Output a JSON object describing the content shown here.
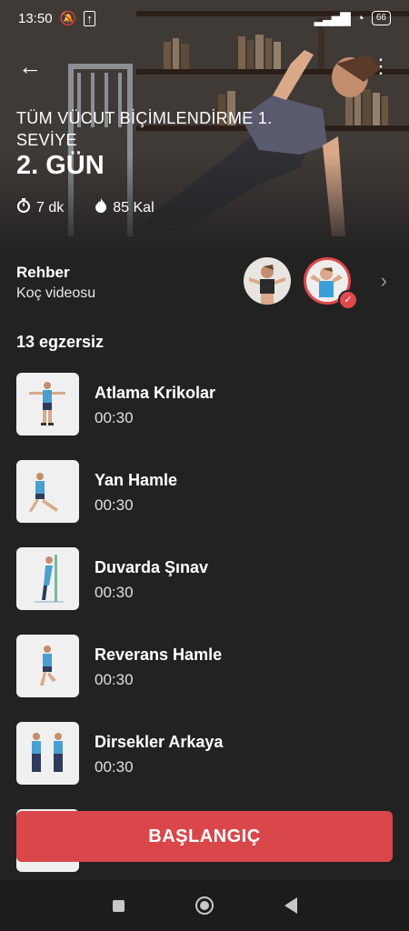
{
  "status_bar": {
    "time": "13:50",
    "battery": "66"
  },
  "header": {
    "program_title": "TÜM VÜCUT BİÇİMLENDİRME 1. SEVİYE",
    "day_title": "2. GÜN",
    "duration": "7 dk",
    "calories": "85 Kal"
  },
  "guide": {
    "title": "Rehber",
    "subtitle": "Koç videosu"
  },
  "exercise_count": "13 egzersiz",
  "exercises": [
    {
      "name": "Atlama Krikolar",
      "time": "00:30"
    },
    {
      "name": "Yan Hamle",
      "time": "00:30"
    },
    {
      "name": "Duvarda Şınav",
      "time": "00:30"
    },
    {
      "name": "Reverans Hamle",
      "time": "00:30"
    },
    {
      "name": "Dirsekler Arkaya",
      "time": "00:30"
    }
  ],
  "start_button": "BAŞLANGIÇ",
  "colors": {
    "accent": "#d9474b",
    "background": "#222222"
  }
}
